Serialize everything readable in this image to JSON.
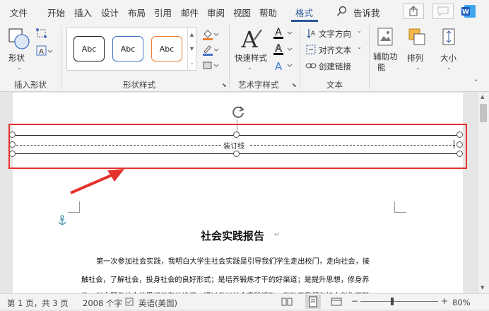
{
  "tabs": {
    "file": "文件",
    "home": "开始",
    "insert": "插入",
    "design": "设计",
    "layout": "布局",
    "references": "引用",
    "mailings": "邮件",
    "review": "审阅",
    "view": "视图",
    "help": "帮助",
    "format": "格式",
    "tell_me": "告诉我"
  },
  "ribbon": {
    "insert_shapes": {
      "shape_label": "形状",
      "group": "插入形状"
    },
    "shape_styles": {
      "items": [
        "Abc",
        "Abc",
        "Abc"
      ],
      "group": "形状样式",
      "colors": [
        "#222222",
        "#4472c4",
        "#ed7d31"
      ]
    },
    "wordart": {
      "quick_styles": "快速样式",
      "group": "艺术字样式"
    },
    "text": {
      "text_direction": "文字方向",
      "align_text": "对齐文本",
      "create_link": "创建链接",
      "group": "文本"
    },
    "arrange": {
      "alt_text": "辅助功",
      "alt_text2": "能",
      "arrange": "排列",
      "size": "大小"
    }
  },
  "document": {
    "binding_line_label": "装订线",
    "heading": "社会实践报告",
    "paragraph_lines": [
      "第一次参加社会实践，我明白大学生社会实践是引导我们学生走出校门，走向社会，接",
      "触社会，了解社会，投身社会的良好形式；是培养锻炼才干的好渠道；是提升思想，修身养",
      "性，树立服务社会的思想的有效途径。通过参加社会实践活动，有助于我们在校中学生更新"
    ]
  },
  "status": {
    "page": "第 1 页，共 3 页",
    "words": "2008 个字",
    "language": "英语(美国)",
    "zoom": "80%"
  },
  "accent": "#2b579a",
  "highlight": "#e5322d"
}
